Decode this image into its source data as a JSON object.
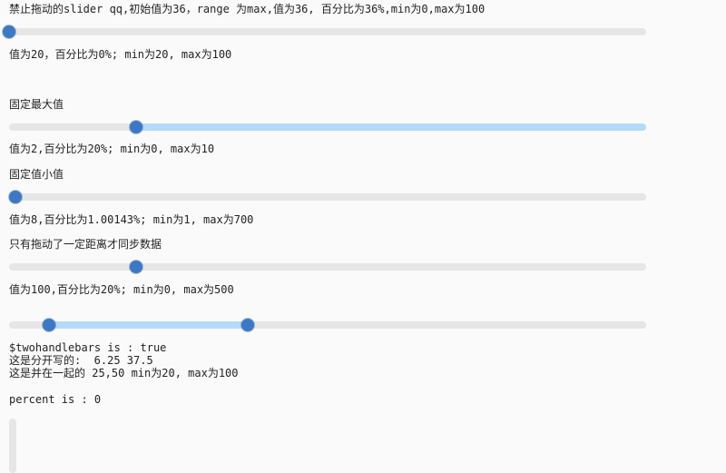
{
  "line1": "禁止拖动的slider qq,初始值为36，range 为max,值为36, 百分比为36%,min为0,max为100",
  "slider1": {
    "value": 0,
    "fill_from": null,
    "fill_to": null
  },
  "line2": "值为20，百分比为0%; min为20, max为100",
  "line3": "固定最大值",
  "slider2": {
    "value": 0.2,
    "fill_from": 0.2,
    "fill_to": 1.0
  },
  "line4": "值为2,百分比为20%; min为0, max为10",
  "line5": "固定值小值",
  "slider3": {
    "value": 0.01,
    "fill_from": null,
    "fill_to": null
  },
  "line6": "值为8,百分比为1.00143%; min为1, max为700",
  "line7": "只有拖动了一定距离才同步数据",
  "slider4": {
    "value": 0.2,
    "fill_from": null,
    "fill_to": null
  },
  "line8": "值为100,百分比为20%; min为0, max为500",
  "slider5": {
    "low": 0.0625,
    "high": 0.375
  },
  "line9": "$twohandlebars is : true",
  "line10": "这是分开写的:  6.25 37.5",
  "line11": "这是并在一起的 25,50 min为20, max为100",
  "line12": "percent is : 0"
}
